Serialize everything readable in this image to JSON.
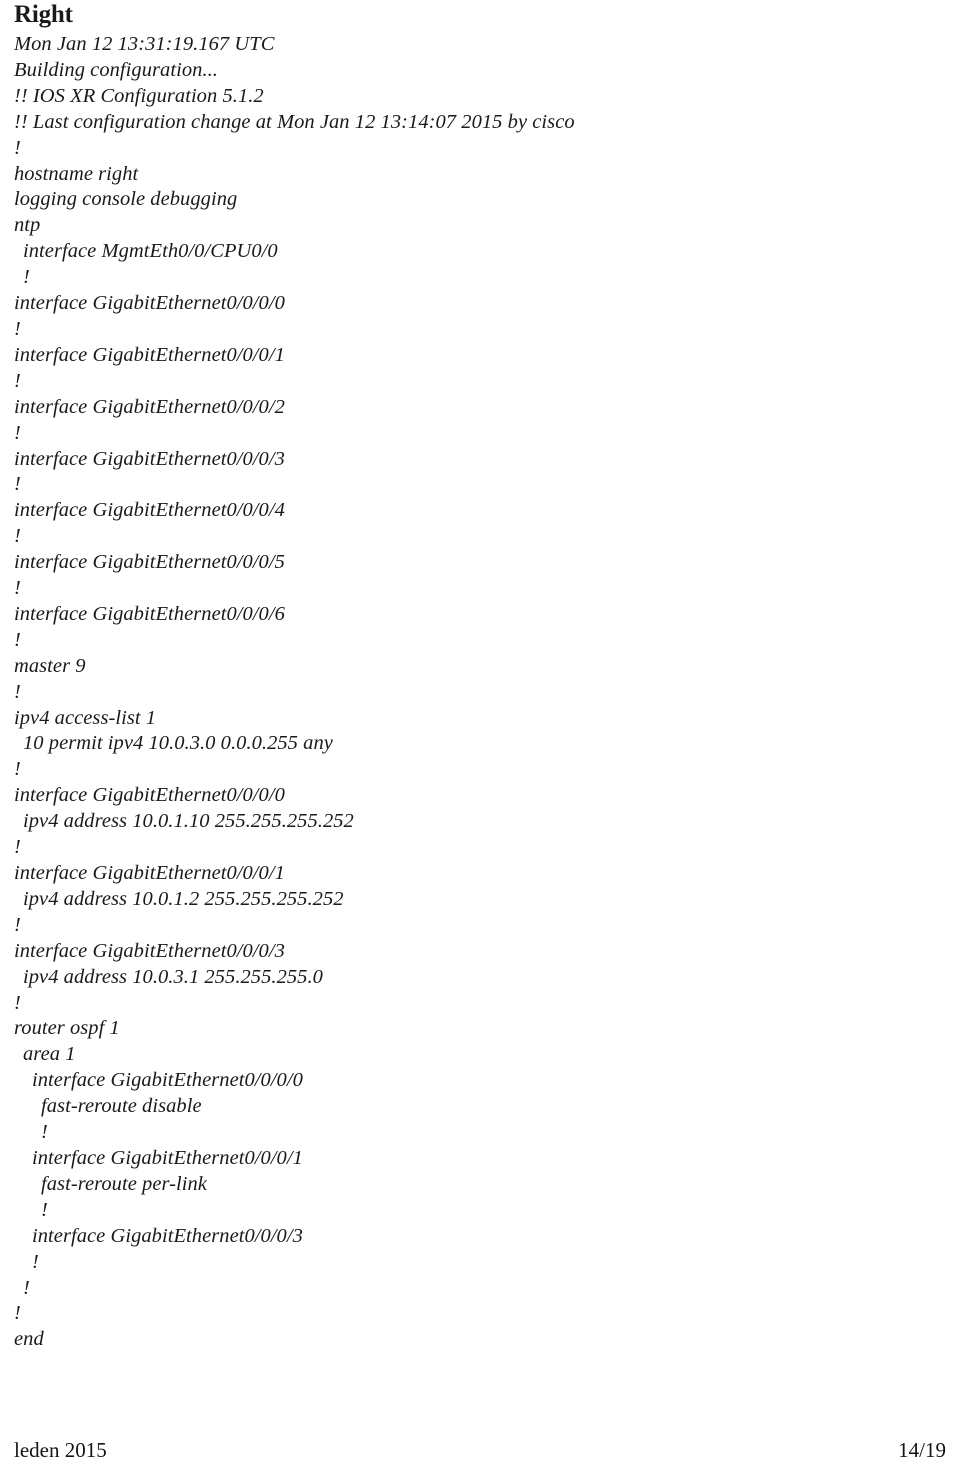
{
  "slide": {
    "title": "Right",
    "config_lines": [
      {
        "text": "Mon Jan 12 13:31:19.167 UTC",
        "indent": 0
      },
      {
        "text": "Building configuration...",
        "indent": 0
      },
      {
        "text": "!! IOS XR Configuration 5.1.2",
        "indent": 0
      },
      {
        "text": "!! Last configuration change at Mon Jan 12 13:14:07 2015 by cisco",
        "indent": 0
      },
      {
        "text": "!",
        "indent": 0
      },
      {
        "text": "hostname right",
        "indent": 0
      },
      {
        "text": "logging console debugging",
        "indent": 0
      },
      {
        "text": "ntp",
        "indent": 0
      },
      {
        "text": "interface MgmtEth0/0/CPU0/0",
        "indent": 1
      },
      {
        "text": "!",
        "indent": 1
      },
      {
        "text": "interface GigabitEthernet0/0/0/0",
        "indent": 0
      },
      {
        "text": "!",
        "indent": 0
      },
      {
        "text": "interface GigabitEthernet0/0/0/1",
        "indent": 0
      },
      {
        "text": "!",
        "indent": 0
      },
      {
        "text": "interface GigabitEthernet0/0/0/2",
        "indent": 0
      },
      {
        "text": "!",
        "indent": 0
      },
      {
        "text": "interface GigabitEthernet0/0/0/3",
        "indent": 0
      },
      {
        "text": "!",
        "indent": 0
      },
      {
        "text": "interface GigabitEthernet0/0/0/4",
        "indent": 0
      },
      {
        "text": "!",
        "indent": 0
      },
      {
        "text": "interface GigabitEthernet0/0/0/5",
        "indent": 0
      },
      {
        "text": "!",
        "indent": 0
      },
      {
        "text": "interface GigabitEthernet0/0/0/6",
        "indent": 0
      },
      {
        "text": "!",
        "indent": 0
      },
      {
        "text": "master 9",
        "indent": 0
      },
      {
        "text": "!",
        "indent": 0
      },
      {
        "text": "ipv4 access-list 1",
        "indent": 0
      },
      {
        "text": "10 permit ipv4 10.0.3.0 0.0.0.255 any",
        "indent": 1
      },
      {
        "text": "!",
        "indent": 0
      },
      {
        "text": "interface GigabitEthernet0/0/0/0",
        "indent": 0
      },
      {
        "text": "ipv4 address 10.0.1.10 255.255.255.252",
        "indent": 1
      },
      {
        "text": "!",
        "indent": 0
      },
      {
        "text": "interface GigabitEthernet0/0/0/1",
        "indent": 0
      },
      {
        "text": "ipv4 address 10.0.1.2 255.255.255.252",
        "indent": 1
      },
      {
        "text": "!",
        "indent": 0
      },
      {
        "text": "interface GigabitEthernet0/0/0/3",
        "indent": 0
      },
      {
        "text": "ipv4 address 10.0.3.1 255.255.255.0",
        "indent": 1
      },
      {
        "text": "!",
        "indent": 0
      },
      {
        "text": "router ospf 1",
        "indent": 0
      },
      {
        "text": "area 1",
        "indent": 1
      },
      {
        "text": "interface GigabitEthernet0/0/0/0",
        "indent": 2
      },
      {
        "text": "fast-reroute disable",
        "indent": 3
      },
      {
        "text": "!",
        "indent": 3
      },
      {
        "text": "interface GigabitEthernet0/0/0/1",
        "indent": 2
      },
      {
        "text": "fast-reroute per-link",
        "indent": 3
      },
      {
        "text": "!",
        "indent": 3
      },
      {
        "text": "interface GigabitEthernet0/0/0/3",
        "indent": 2
      },
      {
        "text": "!",
        "indent": 2
      },
      {
        "text": "!",
        "indent": 1
      },
      {
        "text": "!",
        "indent": 0
      },
      {
        "text": "end",
        "indent": 0
      }
    ]
  },
  "footer": {
    "left": "leden 2015",
    "right": "14/19"
  }
}
